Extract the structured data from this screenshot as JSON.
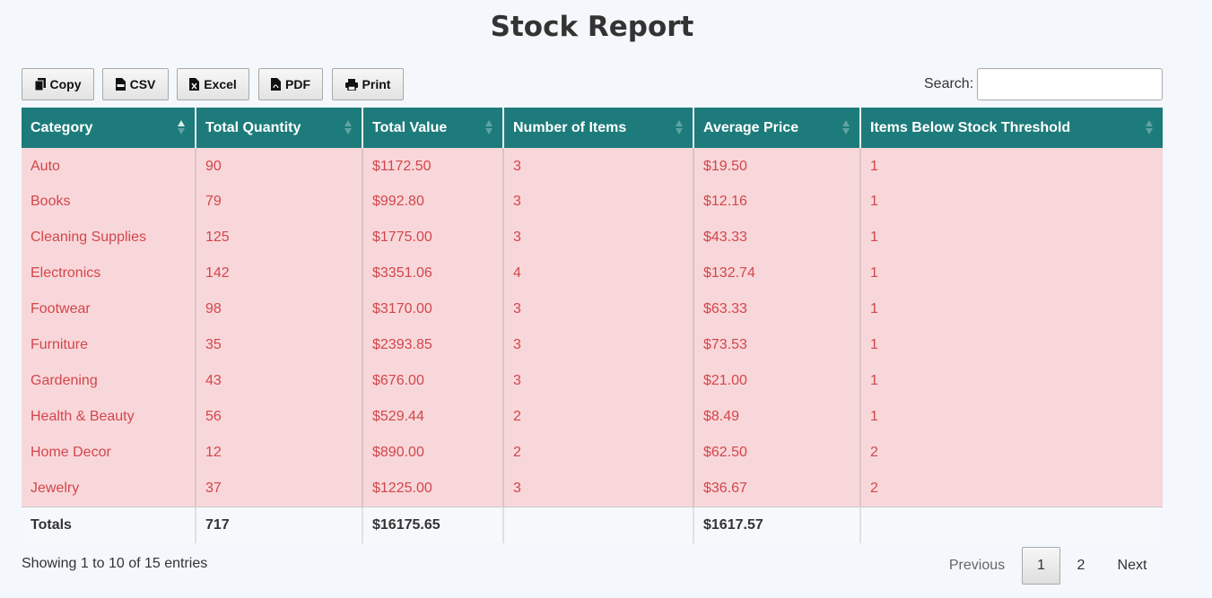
{
  "page": {
    "title": "Stock Report"
  },
  "toolbar": {
    "buttons": [
      {
        "label": "Copy",
        "icon": "copy-icon"
      },
      {
        "label": "CSV",
        "icon": "csv-file-icon"
      },
      {
        "label": "Excel",
        "icon": "excel-file-icon"
      },
      {
        "label": "PDF",
        "icon": "pdf-file-icon"
      },
      {
        "label": "Print",
        "icon": "print-icon"
      }
    ]
  },
  "search": {
    "label": "Search:",
    "value": "",
    "placeholder": ""
  },
  "table": {
    "columns": [
      {
        "label": "Category",
        "sort": "ascending"
      },
      {
        "label": "Total Quantity",
        "sort": "none"
      },
      {
        "label": "Total Value",
        "sort": "none"
      },
      {
        "label": "Number of Items",
        "sort": "none"
      },
      {
        "label": "Average Price",
        "sort": "none"
      },
      {
        "label": "Items Below Stock Threshold",
        "sort": "none"
      }
    ],
    "rows": [
      [
        "Auto",
        "90",
        "$1172.50",
        "3",
        "$19.50",
        "1"
      ],
      [
        "Books",
        "79",
        "$992.80",
        "3",
        "$12.16",
        "1"
      ],
      [
        "Cleaning Supplies",
        "125",
        "$1775.00",
        "3",
        "$43.33",
        "1"
      ],
      [
        "Electronics",
        "142",
        "$3351.06",
        "4",
        "$132.74",
        "1"
      ],
      [
        "Footwear",
        "98",
        "$3170.00",
        "3",
        "$63.33",
        "1"
      ],
      [
        "Furniture",
        "35",
        "$2393.85",
        "3",
        "$73.53",
        "1"
      ],
      [
        "Gardening",
        "43",
        "$676.00",
        "3",
        "$21.00",
        "1"
      ],
      [
        "Health & Beauty",
        "56",
        "$529.44",
        "2",
        "$8.49",
        "1"
      ],
      [
        "Home Decor",
        "12",
        "$890.00",
        "2",
        "$62.50",
        "2"
      ],
      [
        "Jewelry",
        "37",
        "$1225.00",
        "3",
        "$36.67",
        "2"
      ]
    ],
    "footer": [
      "Totals",
      "717",
      "$16175.65",
      "",
      "$1617.57",
      ""
    ]
  },
  "info": {
    "text": "Showing 1 to 10 of 15 entries"
  },
  "pagination": {
    "previous": "Previous",
    "pages": [
      "1",
      "2"
    ],
    "current": "1",
    "next": "Next"
  },
  "colors": {
    "header_bg": "#1e7b7b",
    "row_bg": "#f8d7da",
    "row_text": "#d2464b",
    "page_bg": "#f4f7fb"
  }
}
